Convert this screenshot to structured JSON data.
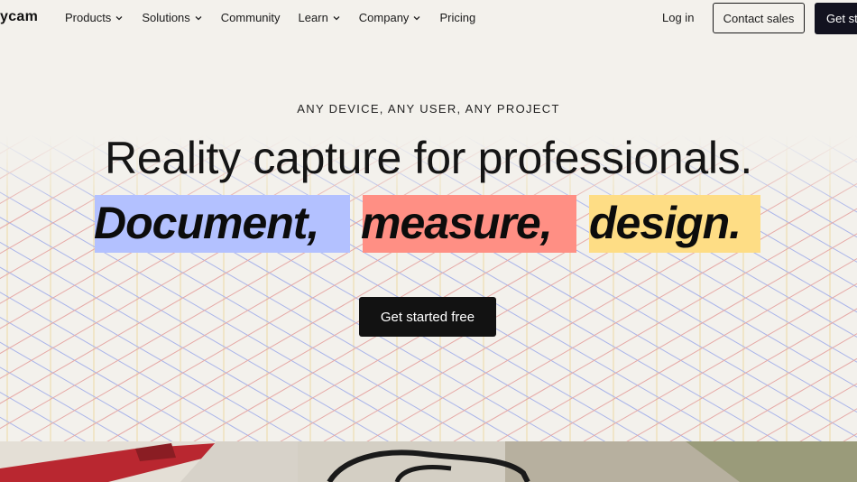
{
  "brand": {
    "logo_text": "ycam"
  },
  "nav": {
    "items": [
      {
        "label": "Products",
        "has_dropdown": true
      },
      {
        "label": "Solutions",
        "has_dropdown": true
      },
      {
        "label": "Community",
        "has_dropdown": false
      },
      {
        "label": "Learn",
        "has_dropdown": true
      },
      {
        "label": "Company",
        "has_dropdown": true
      },
      {
        "label": "Pricing",
        "has_dropdown": false
      }
    ],
    "login_label": "Log in",
    "contact_label": "Contact sales",
    "get_started_label": "Get st"
  },
  "hero": {
    "eyebrow": "ANY DEVICE, ANY USER, ANY PROJECT",
    "headline": "Reality capture for professionals.",
    "highlights": [
      {
        "text": "Document,",
        "color": "#b3c1ff"
      },
      {
        "text": "measure,",
        "color": "#ff8f84"
      },
      {
        "text": "design.",
        "color": "#fedd85"
      }
    ],
    "cta_label": "Get started free"
  },
  "colors": {
    "background": "#f3f1ec",
    "dark_button": "#121212",
    "grid_red": "#e6a9a6",
    "grid_blue": "#a9b4ea",
    "grid_yellow": "#ecd9a4"
  }
}
